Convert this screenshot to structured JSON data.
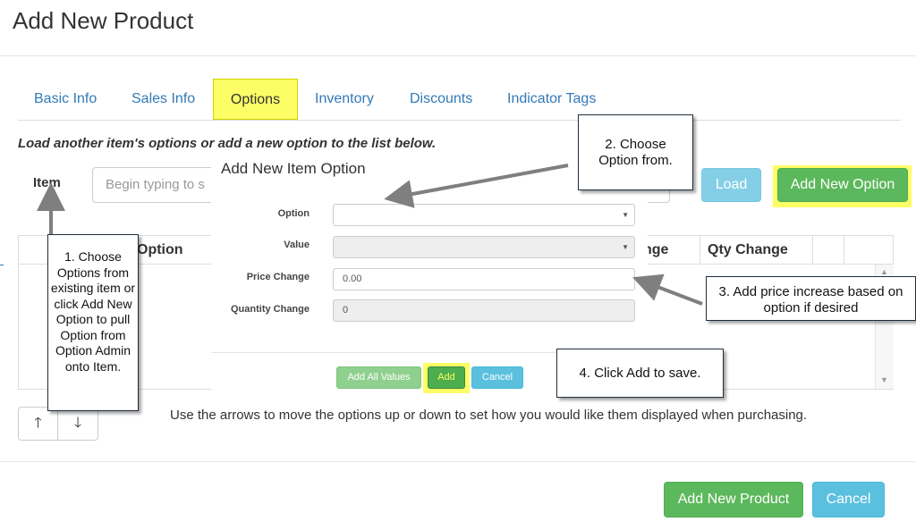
{
  "page": {
    "title": "Add New Product"
  },
  "tabs": [
    {
      "label": "Basic Info"
    },
    {
      "label": "Sales Info"
    },
    {
      "label": "Options"
    },
    {
      "label": "Inventory"
    },
    {
      "label": "Discounts"
    },
    {
      "label": "Indicator Tags"
    }
  ],
  "active_tab": "Options",
  "options_panel": {
    "hint": "Load another item's options or add a new option to the list below.",
    "item_label": "Item",
    "item_placeholder": "Begin typing to s",
    "load_button": "Load",
    "add_new_option_button": "Add New Option",
    "table_headers": [
      "Option",
      "nge",
      "Qty Change"
    ],
    "arrows_help": "Use the arrows to move the options up or down to set how you would like them displayed when purchasing."
  },
  "modal": {
    "title": "Add New Item Option",
    "fields": {
      "option_label": "Option",
      "option_value": "",
      "value_label": "Value",
      "value_value": "",
      "price_label": "Price Change",
      "price_value": "0.00",
      "qty_label": "Quantity Change",
      "qty_value": "0"
    },
    "buttons": {
      "add_all_values": "Add All Values",
      "add": "Add",
      "cancel": "Cancel"
    }
  },
  "footer": {
    "add_product_button": "Add New Product",
    "cancel_button": "Cancel"
  },
  "callouts": {
    "c1": "1. Choose Options from existing item or click Add New Option to pull Option from Option Admin onto Item.",
    "c2": "2. Choose Option from.",
    "c3": "3. Add price increase based on option if desired",
    "c4": "4. Click Add to save."
  },
  "colors": {
    "highlight": "#fdfd66",
    "green": "#5cb85c",
    "blue": "#5bc0de",
    "link": "#337ab7"
  }
}
